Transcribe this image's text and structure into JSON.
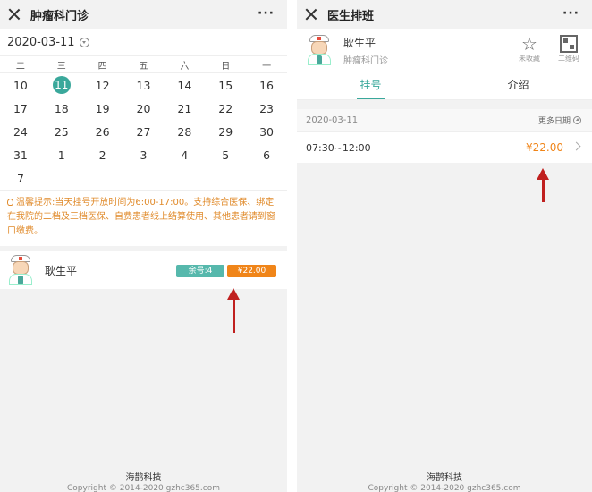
{
  "left": {
    "title": "肿瘤科门诊",
    "more": "···",
    "date": "2020-03-11",
    "weekdays": [
      "二",
      "三",
      "四",
      "五",
      "六",
      "日",
      "一"
    ],
    "days": [
      "10",
      "11",
      "12",
      "13",
      "14",
      "15",
      "16",
      "17",
      "18",
      "19",
      "20",
      "21",
      "22",
      "23",
      "24",
      "25",
      "26",
      "27",
      "28",
      "29",
      "30",
      "31",
      "1",
      "2",
      "3",
      "4",
      "5",
      "6",
      "7"
    ],
    "selected_day": "11",
    "notice": "温馨提示:当天挂号开放时间为6:00-17:00。支持综合医保、绑定在我院的二档及三档医保、自费患者线上结算使用、其他患者请到窗口缴费。",
    "doctor": {
      "name": "耿生平",
      "remaining": "余号:4",
      "price": "¥22.00"
    },
    "footer": {
      "brand": "海鹊科技",
      "copyright": "Copyright © 2014-2020 gzhc365.com"
    }
  },
  "right": {
    "title": "医生排班",
    "more": "···",
    "doctor": {
      "name": "耿生平",
      "dept": "肿瘤科门诊"
    },
    "actions": {
      "favorite": "未收藏",
      "qrcode": "二维码"
    },
    "tabs": [
      "挂号",
      "介绍"
    ],
    "date": "2020-03-11",
    "more_dates": "更多日期",
    "slot": {
      "time": "07:30~12:00",
      "price": "¥22.00"
    },
    "footer": {
      "brand": "海鹊科技",
      "copyright": "Copyright © 2014-2020 gzhc365.com"
    }
  },
  "colors": {
    "accent": "#3aa89b",
    "price": "#f08519",
    "annotation_arrow": "#c0201f"
  }
}
